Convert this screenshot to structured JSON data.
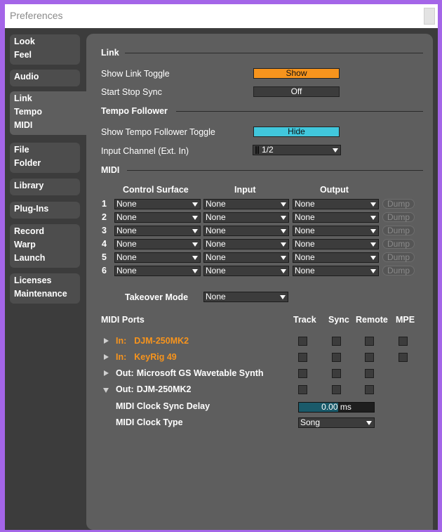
{
  "window": {
    "title": "Preferences"
  },
  "sidebar": {
    "items": [
      {
        "lines": [
          "Look",
          "Feel"
        ]
      },
      {
        "lines": [
          "Audio"
        ]
      },
      {
        "lines": [
          "Link",
          "Tempo",
          "MIDI"
        ],
        "active": true
      },
      {
        "lines": [
          "File",
          "Folder"
        ]
      },
      {
        "lines": [
          "Library"
        ]
      },
      {
        "lines": [
          "Plug-Ins"
        ]
      },
      {
        "lines": [
          "Record",
          "Warp",
          "Launch"
        ]
      },
      {
        "lines": [
          "Licenses",
          "Maintenance"
        ]
      }
    ]
  },
  "link": {
    "section_title": "Link",
    "show_link_toggle_label": "Show Link Toggle",
    "show_link_toggle_value": "Show",
    "start_stop_sync_label": "Start Stop Sync",
    "start_stop_sync_value": "Off"
  },
  "tempo_follower": {
    "section_title": "Tempo Follower",
    "toggle_label": "Show Tempo Follower Toggle",
    "toggle_value": "Hide",
    "input_channel_label": "Input Channel (Ext. In)",
    "input_channel_value": "1/2"
  },
  "midi": {
    "section_title": "MIDI",
    "col_control_surface": "Control Surface",
    "col_input": "Input",
    "col_output": "Output",
    "dump_label": "Dump",
    "rows": [
      {
        "num": "1",
        "surface": "None",
        "input": "None",
        "output": "None"
      },
      {
        "num": "2",
        "surface": "None",
        "input": "None",
        "output": "None"
      },
      {
        "num": "3",
        "surface": "None",
        "input": "None",
        "output": "None"
      },
      {
        "num": "4",
        "surface": "None",
        "input": "None",
        "output": "None"
      },
      {
        "num": "5",
        "surface": "None",
        "input": "None",
        "output": "None"
      },
      {
        "num": "6",
        "surface": "None",
        "input": "None",
        "output": "None"
      }
    ],
    "takeover_label": "Takeover Mode",
    "takeover_value": "None"
  },
  "midi_ports": {
    "title": "MIDI Ports",
    "col_track": "Track",
    "col_sync": "Sync",
    "col_remote": "Remote",
    "col_mpe": "MPE",
    "ports": [
      {
        "prefix": "In:",
        "name": "DJM-250MK2",
        "expanded": false,
        "mpe": true
      },
      {
        "prefix": "In:",
        "name": "KeyRig 49",
        "expanded": false,
        "mpe": true
      },
      {
        "prefix": "Out:",
        "name": "Microsoft GS Wavetable Synth",
        "expanded": false,
        "mpe": false
      },
      {
        "prefix": "Out:",
        "name": "DJM-250MK2",
        "expanded": true,
        "mpe": false
      }
    ],
    "clock_sync_delay_label": "MIDI Clock Sync Delay",
    "clock_sync_delay_value": "0.00",
    "clock_sync_delay_unit": "ms",
    "clock_type_label": "MIDI Clock Type",
    "clock_type_value": "Song"
  },
  "colors": {
    "accent_orange": "#f7941d",
    "accent_cyan": "#41c7dc",
    "window_frame": "#a465e8"
  }
}
